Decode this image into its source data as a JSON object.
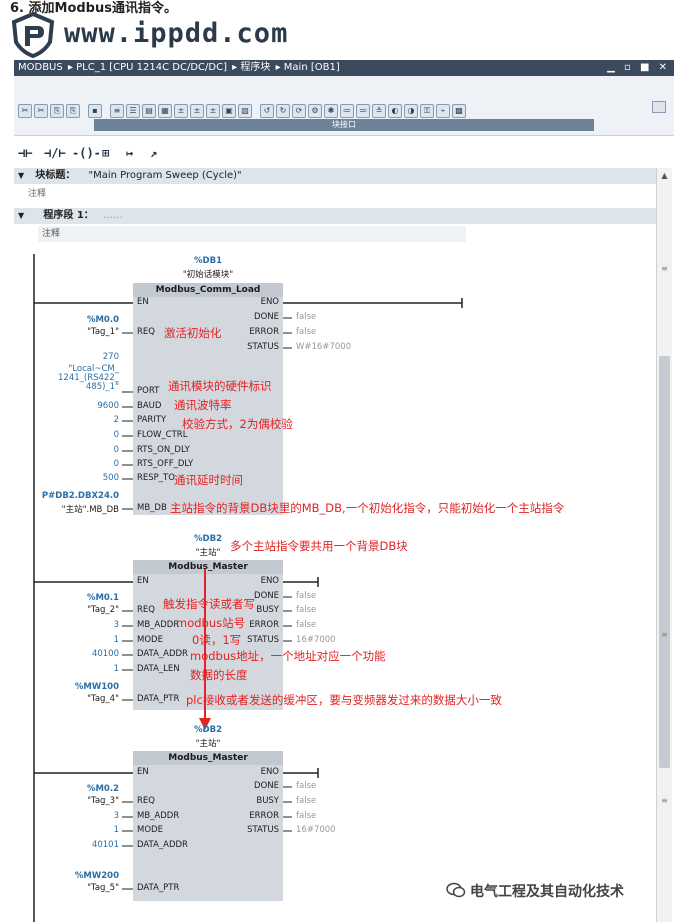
{
  "heading": "6. 添加Modbus通讯指令。",
  "watermark": "www.ippdd.com",
  "titlebar": {
    "crumbs": [
      "MODBUS",
      "PLC_1 [CPU 1214C DC/DC/DC]",
      "程序块",
      "Main [OB1]"
    ],
    "separator": "▸",
    "controls": "▁ ▫ ■ ✕"
  },
  "toolbar": {
    "interface_label": "块接口"
  },
  "favorites": [
    "⊣⊢",
    "⊣/⊢",
    "-()-",
    "⊞",
    "↦",
    "↗"
  ],
  "editor": {
    "block_title_label": "块标题：",
    "block_title_value": "\"Main Program Sweep (Cycle)\"",
    "block_comment": "注释",
    "network_label": "程序段 1：",
    "network_dots": "……",
    "network_comment": "注释"
  },
  "fb1": {
    "db": "%DB1",
    "db_name": "\"初始话模块\"",
    "title": "Modbus_Comm_Load",
    "en": "EN",
    "eno": "ENO",
    "inputs": [
      {
        "pin": "REQ",
        "addr": "%M0.0",
        "tag": "\"Tag_1\""
      },
      {
        "pin": "PORT",
        "val": "270",
        "tag_lines": [
          "\"Local~CM_",
          "1241_(RS422_",
          "485)_1\""
        ]
      },
      {
        "pin": "BAUD",
        "val": "9600"
      },
      {
        "pin": "PARITY",
        "val": "2"
      },
      {
        "pin": "FLOW_CTRL",
        "val": "0"
      },
      {
        "pin": "RTS_ON_DLY",
        "val": "0"
      },
      {
        "pin": "RTS_OFF_DLY",
        "val": "0"
      },
      {
        "pin": "RESP_TO",
        "val": "500"
      },
      {
        "pin": "MB_DB",
        "addr": "P#DB2.DBX24.0",
        "tag": "\"主站\".MB_DB"
      }
    ],
    "outputs": [
      {
        "pin": "DONE",
        "val": "false"
      },
      {
        "pin": "ERROR",
        "val": "false"
      },
      {
        "pin": "STATUS",
        "val": "W#16#7000"
      }
    ]
  },
  "fb2": {
    "db": "%DB2",
    "db_name": "\"主站\"",
    "title": "Modbus_Master",
    "en": "EN",
    "eno": "ENO",
    "inputs": [
      {
        "pin": "REQ",
        "addr": "%M0.1",
        "tag": "\"Tag_2\""
      },
      {
        "pin": "MB_ADDR",
        "val": "3"
      },
      {
        "pin": "MODE",
        "val": "1"
      },
      {
        "pin": "DATA_ADDR",
        "val": "40100"
      },
      {
        "pin": "DATA_LEN",
        "val": "1"
      },
      {
        "pin": "DATA_PTR",
        "addr": "%MW100",
        "tag": "\"Tag_4\""
      }
    ],
    "outputs": [
      {
        "pin": "DONE",
        "val": "false"
      },
      {
        "pin": "BUSY",
        "val": "false"
      },
      {
        "pin": "ERROR",
        "val": "false"
      },
      {
        "pin": "STATUS",
        "val": "16#7000"
      }
    ]
  },
  "fb3": {
    "db": "%DB2",
    "db_name": "\"主站\"",
    "title": "Modbus_Master",
    "en": "EN",
    "eno": "ENO",
    "inputs": [
      {
        "pin": "REQ",
        "addr": "%M0.2",
        "tag": "\"Tag_3\""
      },
      {
        "pin": "MB_ADDR",
        "val": "3"
      },
      {
        "pin": "MODE",
        "val": "1"
      },
      {
        "pin": "DATA_ADDR",
        "val": "40101"
      },
      {
        "pin": "DATA_PTR",
        "addr": "%MW200",
        "tag": "\"Tag_5\""
      }
    ],
    "outputs": [
      {
        "pin": "DONE",
        "val": "false"
      },
      {
        "pin": "BUSY",
        "val": "false"
      },
      {
        "pin": "ERROR",
        "val": "false"
      },
      {
        "pin": "STATUS",
        "val": "16#7000"
      }
    ]
  },
  "annotations": {
    "req1": "激活初始化",
    "port": "通讯模块的硬件标识",
    "baud": "通讯波特率",
    "parity": "校验方式，2为偶校验",
    "resp": "通讯延时时间",
    "mbdb": "主站指令的背景DB块里的MB_DB,一个初始化指令，只能初始化一个主站指令",
    "shared_db": "多个主站指令要共用一个背景DB块",
    "req2": "触发指令读或者写",
    "station": "modbus站号",
    "mode": "0读，1写",
    "data_addr": "modbus地址，一个地址对应一个功能",
    "data_len": "数据的长度",
    "data_ptr": "plc接收或者发送的缓冲区，要与变频器发过来的数据大小一致"
  },
  "footer": "电气工程及其自动化技术",
  "colors": {
    "annotation": "#e32222",
    "address": "#2a6fa8",
    "block_fill": "#d3d8de",
    "titlebar": "#3b4a5c"
  }
}
